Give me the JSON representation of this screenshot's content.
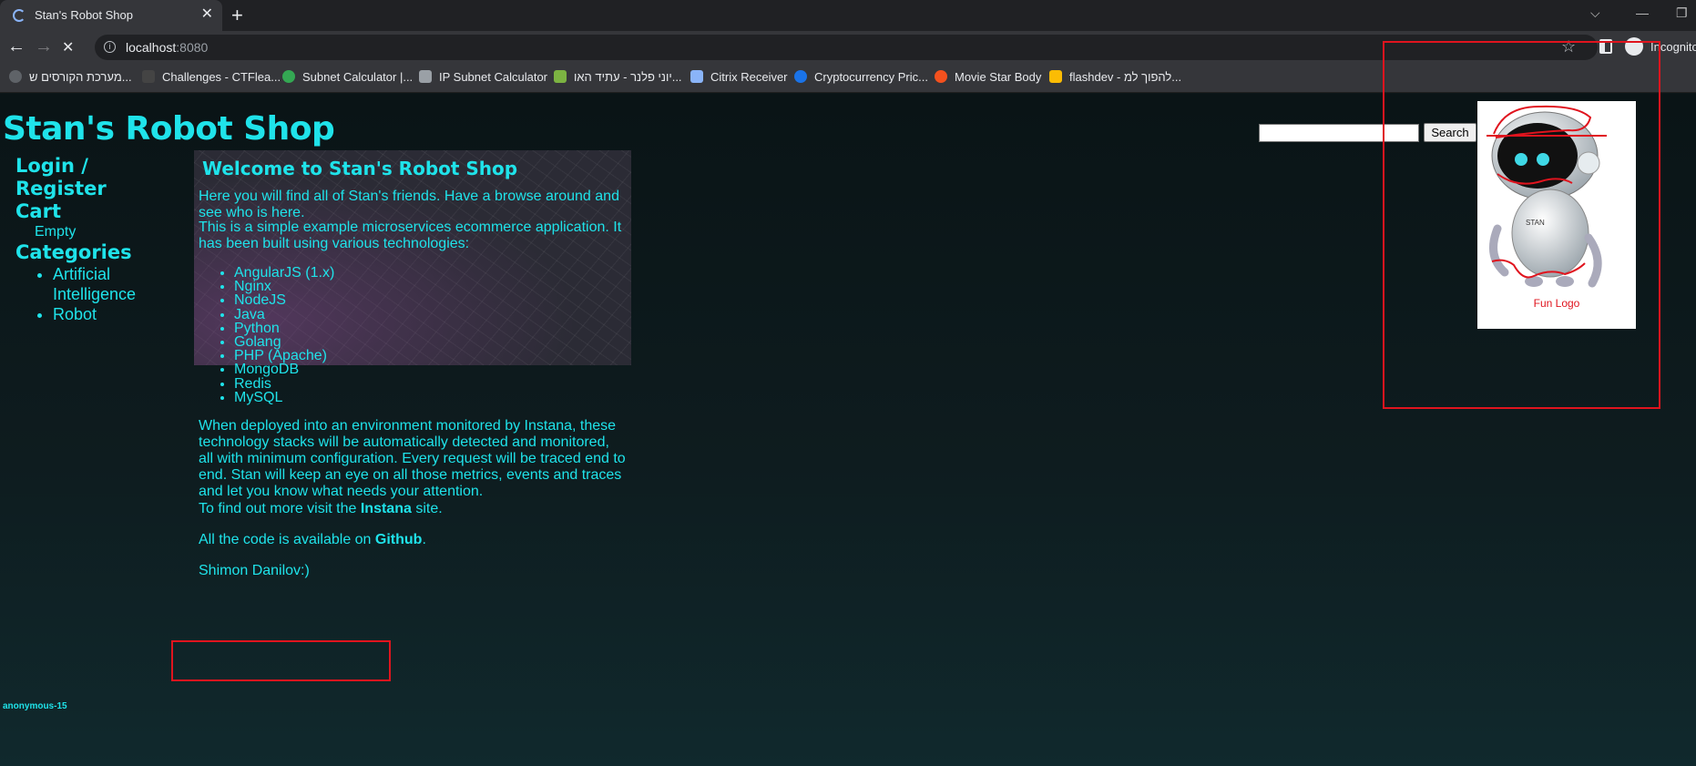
{
  "browser": {
    "tab_title": "Stan's Robot Shop",
    "url_host": "localhost",
    "url_port": ":8080",
    "incognito_label": "Incognito",
    "bookmarks": [
      "מערכת הקורסים ש...",
      "Challenges - CTFlea...",
      "Subnet Calculator |...",
      "IP Subnet Calculator",
      "יוני פלנר - עתיד האו...",
      "Citrix Receiver",
      "Cryptocurrency Pric...",
      "Movie Star Body",
      "flashdev - להפוך למ..."
    ]
  },
  "site": {
    "title": "Stan's Robot Shop",
    "search_button": "Search",
    "search_value": "",
    "sidebar": {
      "login": "Login / Register",
      "cart": "Cart",
      "cart_status": "Empty",
      "categories": "Categories",
      "category_items": [
        "Artificial Intelligence",
        "Robot"
      ]
    },
    "main": {
      "welcome": "Welcome to Stan's Robot Shop",
      "intro": "Here you will find all of Stan's friends. Have a browse around and see who is here.",
      "description": "This is a simple example microservices ecommerce application. It has been built using various technologies:",
      "technologies": [
        "AngularJS (1.x)",
        "Nginx",
        "NodeJS",
        "Java",
        "Python",
        "Golang",
        "PHP (Apache)",
        "MongoDB",
        "Redis",
        "MySQL"
      ],
      "instana_text": "When deployed into an environment monitored by Instana, these technology stacks will be automatically detected and monitored, all with minimum configuration. Every request will be traced end to end. Stan will keep an eye on all those metrics, events and traces and let you know what needs your attention.",
      "find_out_prefix": "To find out more visit the ",
      "find_out_link": "Instana",
      "find_out_suffix": " site.",
      "code_prefix": "All the code is available on ",
      "code_link": "Github",
      "code_suffix": ".",
      "author": "Shimon Danilov:)"
    },
    "logo_caption": "Fun Logo",
    "logo_text": "STAN",
    "user": "anonymous-15"
  },
  "colors": {
    "accent": "#1fe3ea",
    "annotation": "#e0141e"
  }
}
